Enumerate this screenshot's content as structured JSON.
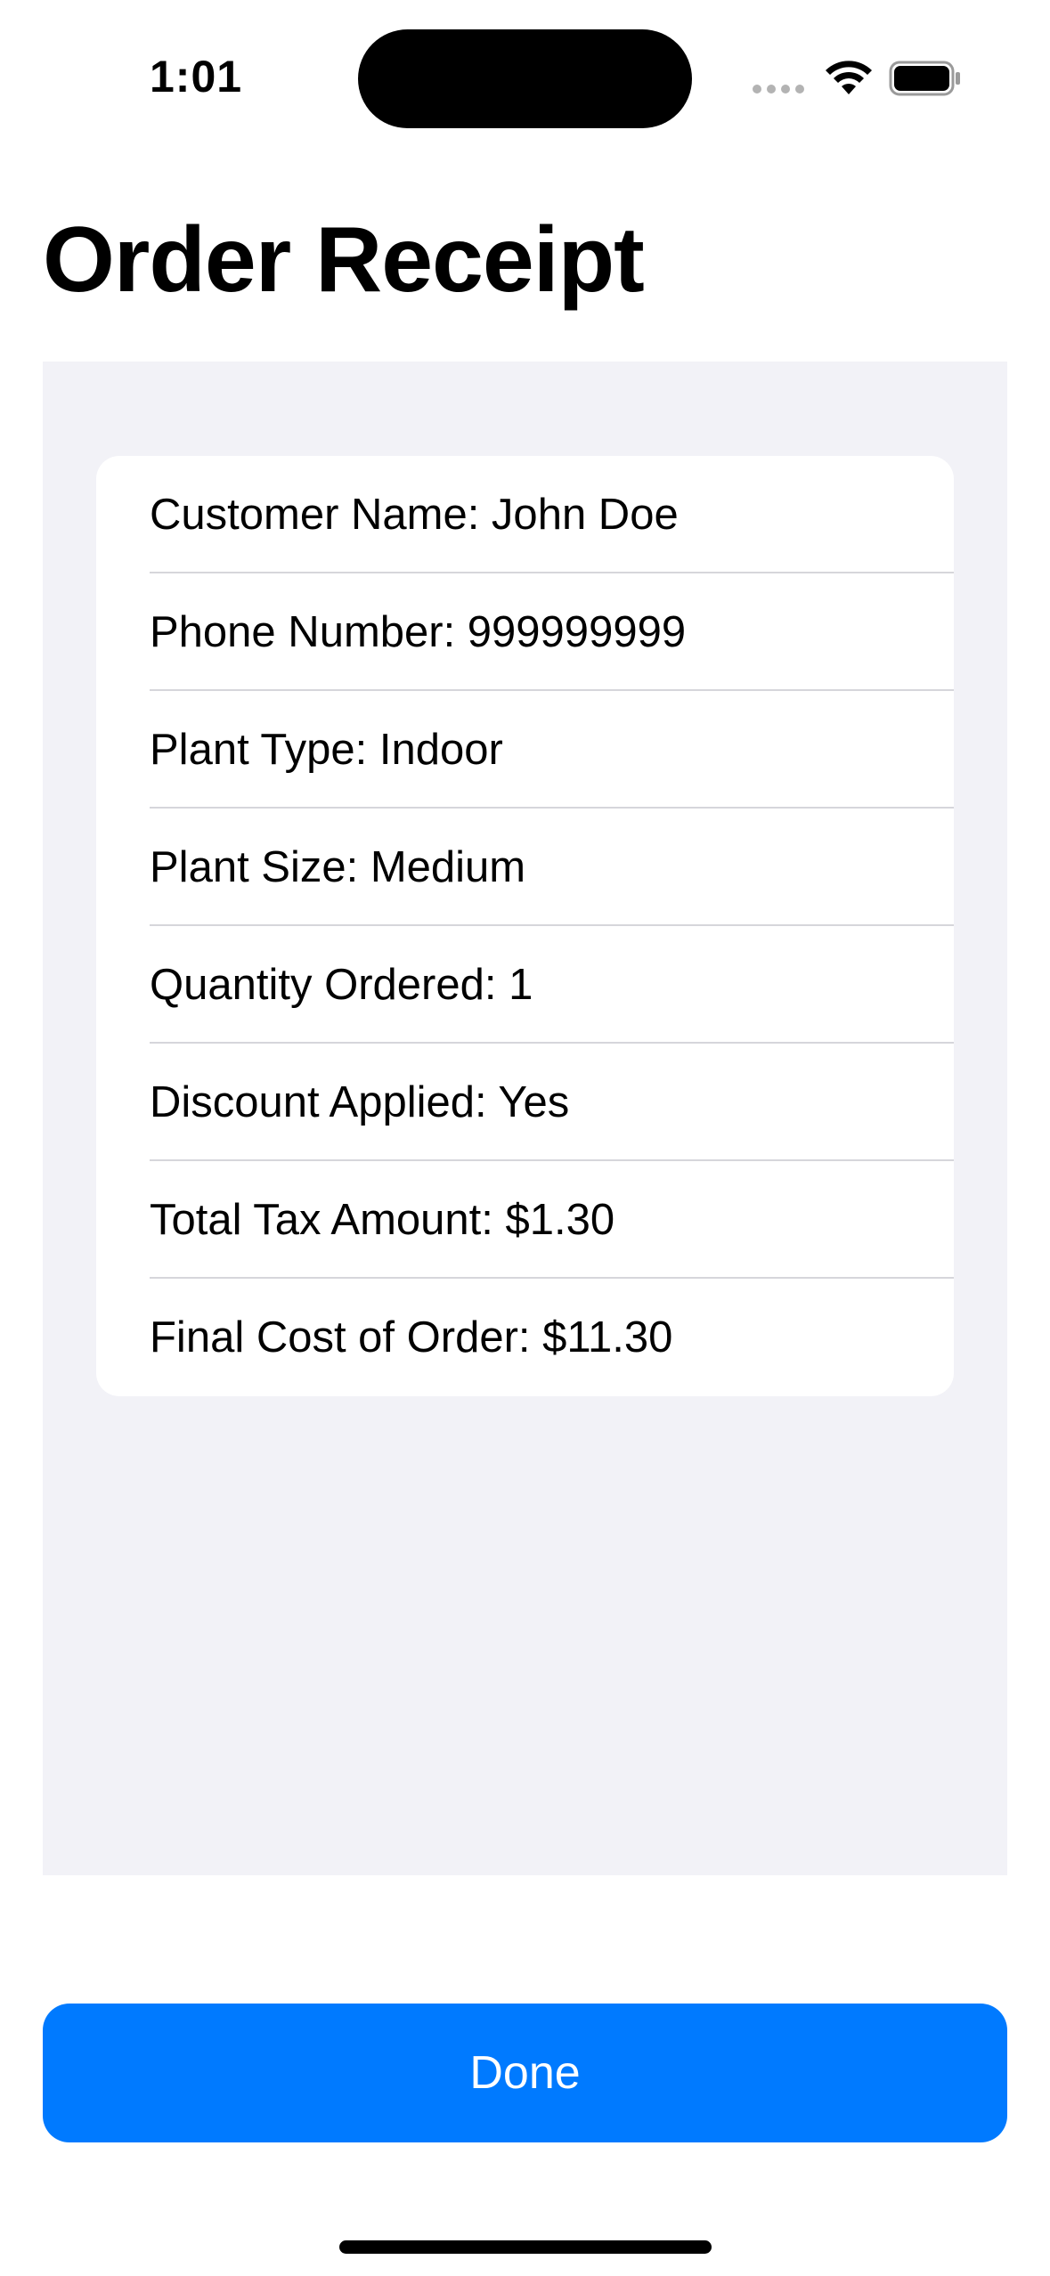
{
  "status_bar": {
    "time": "1:01",
    "signal_icon": "signal-dots-icon",
    "wifi_icon": "wifi-icon",
    "battery_icon": "battery-icon"
  },
  "header": {
    "title": "Order Receipt"
  },
  "receipt": {
    "rows": [
      {
        "text": "Customer Name: John Doe"
      },
      {
        "text": "Phone Number: 999999999"
      },
      {
        "text": "Plant Type: Indoor"
      },
      {
        "text": "Plant Size: Medium"
      },
      {
        "text": "Quantity Ordered: 1"
      },
      {
        "text": "Discount Applied: Yes"
      },
      {
        "text": "Total Tax Amount: $1.30"
      },
      {
        "text": "Final Cost of Order: $11.30"
      }
    ]
  },
  "actions": {
    "done_label": "Done"
  },
  "colors": {
    "accent": "#007aff",
    "grouped_background": "#f2f2f7",
    "card_background": "#ffffff",
    "separator": "#d6d6db"
  }
}
